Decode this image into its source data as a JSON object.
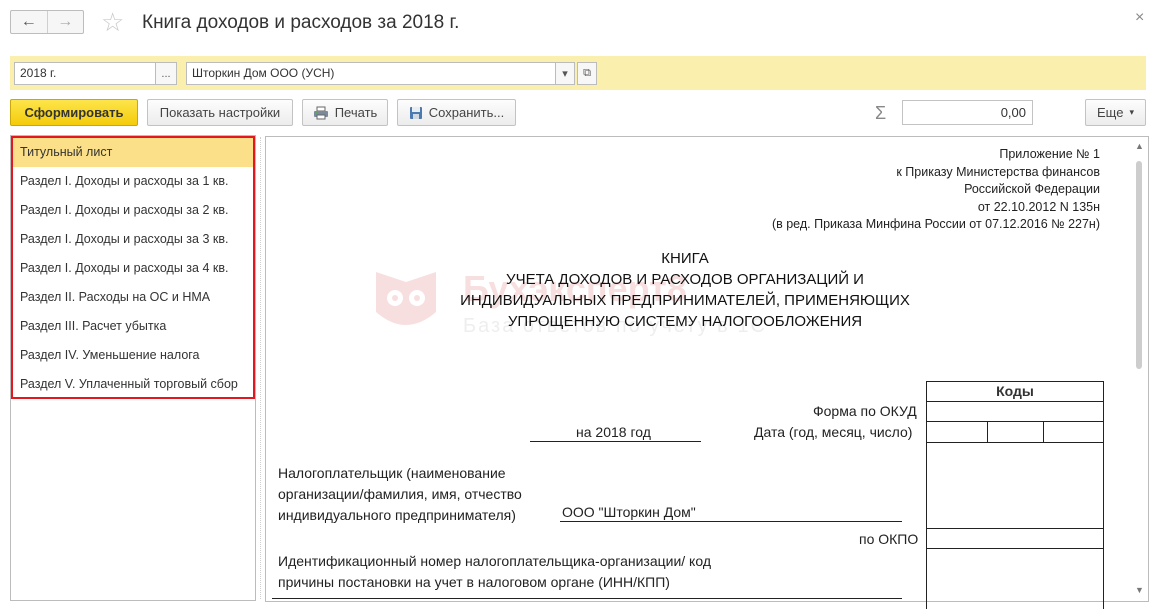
{
  "window": {
    "title": "Книга доходов и расходов за 2018 г.",
    "nav_back": "←",
    "nav_forward": "→",
    "favorite": "☆",
    "close": "×"
  },
  "filters": {
    "period_value": "2018 г.",
    "period_select": "...",
    "organization_value": "Шторкин Дом ООО (УСН)",
    "dropdown_glyph": "▾",
    "open_glyph": "⧉"
  },
  "toolbar": {
    "generate_label": "Сформировать",
    "settings_label": "Показать настройки",
    "print_label": "Печать",
    "save_label": "Сохранить...",
    "sigma": "Σ",
    "sum_value": "0,00",
    "more_label": "Еще"
  },
  "sections": [
    {
      "label": "Титульный лист"
    },
    {
      "label": "Раздел I. Доходы и расходы за 1 кв."
    },
    {
      "label": "Раздел I. Доходы и расходы за 2 кв."
    },
    {
      "label": "Раздел I. Доходы и расходы за 3 кв."
    },
    {
      "label": "Раздел I. Доходы и расходы за 4 кв."
    },
    {
      "label": "Раздел II. Расходы на ОС и НМА"
    },
    {
      "label": "Раздел III. Расчет убытка"
    },
    {
      "label": "Раздел IV. Уменьшение налога"
    },
    {
      "label": "Раздел V. Уплаченный торговый сбор"
    }
  ],
  "selected_section": "Титульный лист",
  "watermark": {
    "brand": "Бухэксперт8",
    "tagline": "База ответов по учету в 1С"
  },
  "report": {
    "approval": [
      "Приложение № 1",
      "к Приказу Министерства финансов",
      "Российской Федерации",
      "от 22.10.2012 N 135н",
      "(в ред. Приказа Минфина России от 07.12.2016 № 227н)"
    ],
    "heading": [
      "КНИГА",
      "УЧЕТА ДОХОДОВ И РАСХОДОВ ОРГАНИЗАЦИЙ И",
      "ИНДИВИДУАЛЬНЫХ ПРЕДПРИНИМАТЕЛЕЙ, ПРИМЕНЯЮЩИХ",
      "УПРОЩЕННУЮ СИСТЕМУ НАЛОГООБЛОЖЕНИЯ"
    ],
    "codes_header": "Коды",
    "okud_label": "Форма по ОКУД",
    "date_label": "Дата (год, месяц, число)",
    "year_text": "на 2018 год",
    "taxpayer_label": [
      "Налогоплательщик (наименование",
      "организации/фамилия, имя, отчество",
      "индивидуального предпринимателя)"
    ],
    "taxpayer_value": "ООО \"Шторкин Дом\"",
    "okpo_label": "по ОКПО",
    "inn_label": [
      "Идентификационный номер налогоплательщика-организации/ код",
      "причины постановки на учет в налоговом органе (ИНН/КПП)"
    ]
  },
  "colors": {
    "filter_bar": "#fbefae",
    "primary_button": "#f4cc0a",
    "selected_row": "#fbe089",
    "highlight_border": "#e3171f"
  }
}
